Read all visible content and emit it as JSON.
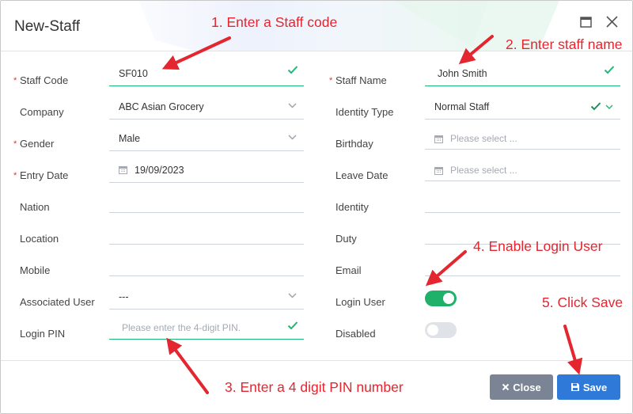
{
  "dialog": {
    "title": "New-Staff"
  },
  "left": [
    {
      "key": "staff_code",
      "label": "Staff Code",
      "required": true,
      "value": "SF010"
    },
    {
      "key": "company",
      "label": "Company",
      "required": false,
      "value": "ABC Asian Grocery"
    },
    {
      "key": "gender",
      "label": "Gender",
      "required": true,
      "value": "Male"
    },
    {
      "key": "entry_date",
      "label": "Entry Date",
      "required": true,
      "value": "19/09/2023"
    },
    {
      "key": "nation",
      "label": "Nation",
      "required": false,
      "value": ""
    },
    {
      "key": "location",
      "label": "Location",
      "required": false,
      "value": ""
    },
    {
      "key": "mobile",
      "label": "Mobile",
      "required": false,
      "value": ""
    },
    {
      "key": "associated_user",
      "label": "Associated User",
      "required": false,
      "value": "---"
    },
    {
      "key": "login_pin",
      "label": "Login PIN",
      "required": false,
      "value": "",
      "placeholder": "Please enter the 4-digit PIN."
    }
  ],
  "right": [
    {
      "key": "staff_name",
      "label": "Staff Name",
      "required": true,
      "value": "John Smith"
    },
    {
      "key": "identity_type",
      "label": "Identity Type",
      "required": false,
      "value": "Normal Staff"
    },
    {
      "key": "birthday",
      "label": "Birthday",
      "required": false,
      "placeholder": "Please select ..."
    },
    {
      "key": "leave_date",
      "label": "Leave Date",
      "required": false,
      "placeholder": "Please select ..."
    },
    {
      "key": "identity",
      "label": "Identity",
      "required": false,
      "value": ""
    },
    {
      "key": "duty",
      "label": "Duty",
      "required": false,
      "value": ""
    },
    {
      "key": "email",
      "label": "Email",
      "required": false,
      "value": ""
    },
    {
      "key": "login_user",
      "label": "Login User",
      "required": false,
      "toggle": true,
      "on": true
    },
    {
      "key": "disabled",
      "label": "Disabled",
      "required": false,
      "toggle": true,
      "on": false
    }
  ],
  "buttons": {
    "close": "Close",
    "save": "Save"
  },
  "annotations": {
    "a1": "1. Enter a Staff code",
    "a2": "2. Enter staff name",
    "a3": "3. Enter a 4 digit PIN number",
    "a4": "4. Enable Login User",
    "a5": "5. Click Save"
  },
  "colors": {
    "accent_green": "#20b673",
    "toggle_on": "#1fb16a",
    "toggle_off": "#dfe2e7",
    "close_btn": "#7b8494",
    "save_btn": "#2f7ad8",
    "annotation_red": "#e3262f",
    "required_red": "#d9363e"
  },
  "icons": {
    "maximize": "window-maximize-icon",
    "close": "close-icon",
    "check": "checkmark-icon",
    "chevron": "chevron-down-icon",
    "calendar": "calendar-icon",
    "save": "floppy-disk-icon",
    "close_button": "x-icon"
  }
}
